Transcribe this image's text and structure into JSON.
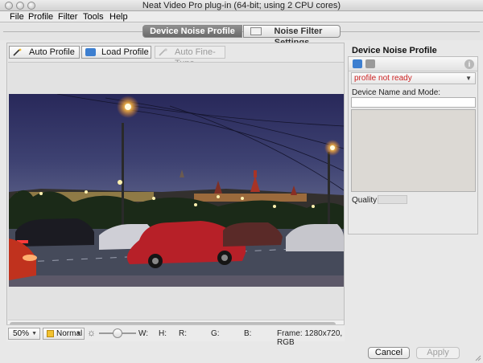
{
  "window": {
    "title": "Neat Video Pro plug-in (64-bit; using 2 CPU cores)"
  },
  "menu": [
    "File",
    "Profile",
    "Filter",
    "Tools",
    "Help"
  ],
  "tabs": [
    {
      "label": "Device Noise Profile",
      "active": true
    },
    {
      "label": "Noise Filter Settings",
      "active": false
    }
  ],
  "toolbar": {
    "auto_profile": "Auto Profile",
    "load_profile": "Load Profile",
    "auto_fine_tune": "Auto Fine-Tune"
  },
  "statusbar": {
    "zoom": "50%",
    "mode": "Normal",
    "w": "W:",
    "h": "H:",
    "r": "R:",
    "g": "G:",
    "b": "B:",
    "frame": "Frame: 1280x720, RGB"
  },
  "profile_panel": {
    "title": "Device Noise Profile",
    "status": "profile not ready",
    "name_label": "Device Name and Mode:",
    "name_value": "",
    "quality_label": "Quality:"
  },
  "buttons": {
    "cancel": "Cancel",
    "apply": "Apply"
  },
  "colors": {
    "accent_blue": "#3d7fd0",
    "status_red": "#cc2222"
  }
}
